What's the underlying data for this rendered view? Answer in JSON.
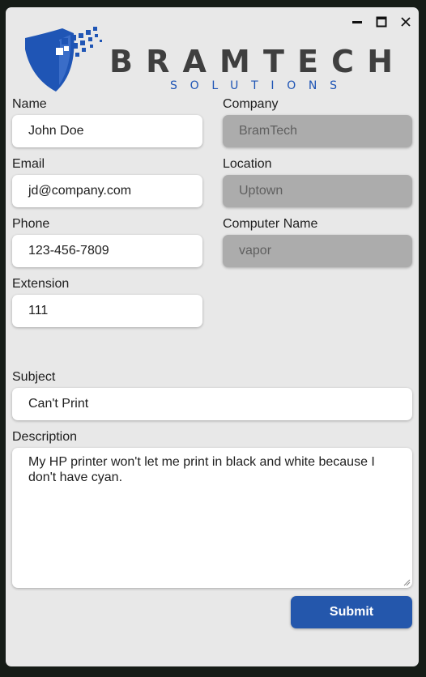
{
  "window": {
    "controls": [
      "minimize-icon",
      "maximize-icon",
      "close-icon"
    ]
  },
  "logo": {
    "brand": "BRAMTECH",
    "tagline": "SOLUTIONS"
  },
  "form": {
    "name": {
      "label": "Name",
      "value": "John Doe"
    },
    "email": {
      "label": "Email",
      "value": "jd@company.com"
    },
    "phone": {
      "label": "Phone",
      "value": "123-456-7809"
    },
    "extension": {
      "label": "Extension",
      "value": "111"
    },
    "company": {
      "label": "Company",
      "value": "BramTech"
    },
    "location": {
      "label": "Location",
      "value": "Uptown"
    },
    "computer_name": {
      "label": "Computer Name",
      "value": "vapor"
    },
    "subject": {
      "label": "Subject",
      "value": "Can't Print"
    },
    "description": {
      "label": "Description",
      "value": "My HP printer won't let me print in black and white because I don't have cyan."
    },
    "submit_label": "Submit"
  },
  "colors": {
    "background": "#161c17",
    "window": "#e8e8e8",
    "field": "#ffffff",
    "disabled_field": "#acacac",
    "accent": "#2457ac",
    "logo_text": "#3f3f3f",
    "tagline": "#1f55b5"
  }
}
